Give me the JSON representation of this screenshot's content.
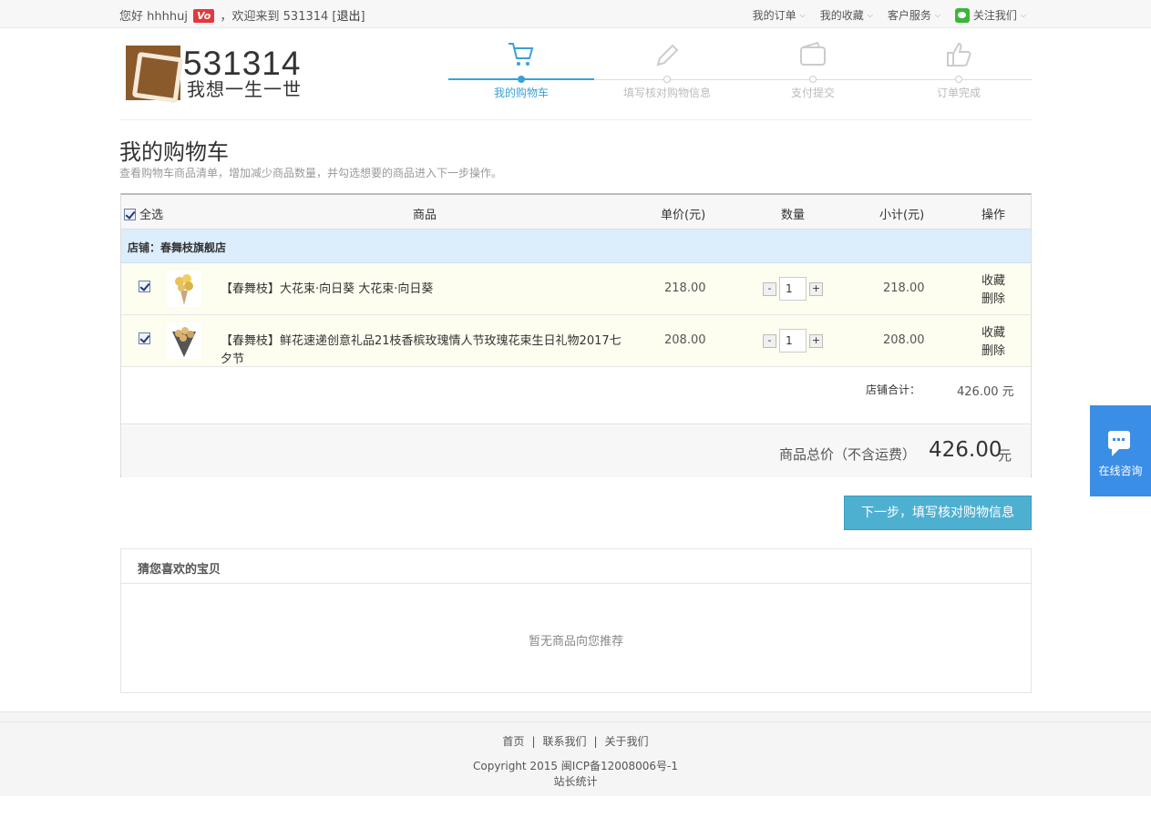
{
  "topbar": {
    "greeting": "您好 hhhhuj",
    "vip_badge": "Vo",
    "welcome": "，欢迎来到 531314 [",
    "logout": "退出",
    "close_bracket": "]",
    "menu": [
      "我的订单",
      "我的收藏",
      "客户服务",
      "关注我们"
    ]
  },
  "logo": {
    "number": "531314",
    "slogan": "我想一生一世"
  },
  "steps": [
    "我的购物车",
    "填写核对购物信息",
    "支付提交",
    "订单完成"
  ],
  "page": {
    "title": "我的购物车",
    "subtitle": "查看购物车商品清单，增加减少商品数量，并勾选想要的商品进入下一步操作。"
  },
  "cart": {
    "headers": {
      "select_all": "全选",
      "product": "商品",
      "unit_price": "单价(元)",
      "quantity": "数量",
      "subtotal": "小计(元)",
      "actions": "操作"
    },
    "shop_label": "店铺：春舞枝旗舰店",
    "items": [
      {
        "name": "【春舞枝】大花束·向日葵 大花束·向日葵",
        "price": "218.00",
        "qty": "1",
        "subtotal": "218.00",
        "fav": "收藏",
        "del": "删除"
      },
      {
        "name": "【春舞枝】鲜花速递创意礼品21枝香槟玫瑰情人节玫瑰花束生日礼物2017七夕节",
        "price": "208.00",
        "qty": "1",
        "subtotal": "208.00",
        "fav": "收藏",
        "del": "删除"
      }
    ],
    "shop_total_label": "店铺合计：",
    "shop_total_value": "426.00 元",
    "grand_label": "商品总价（不含运费）",
    "grand_value": "426.00",
    "grand_unit": "元"
  },
  "next_button": "下一步，填写核对购物信息",
  "recommend": {
    "title": "猜您喜欢的宝贝",
    "empty": "暂无商品向您推荐"
  },
  "footer": {
    "links": [
      "首页",
      "联系我们",
      "关于我们"
    ],
    "copyright": "Copyright 2015 闽ICP备12008006号-1",
    "stats": "站长统计"
  },
  "consult": "在线咨询",
  "colors": {
    "accent": "#3aa0d6",
    "button": "#4eb0d1",
    "consult": "#3b8ee5",
    "shop_row": "#dcedfc"
  }
}
